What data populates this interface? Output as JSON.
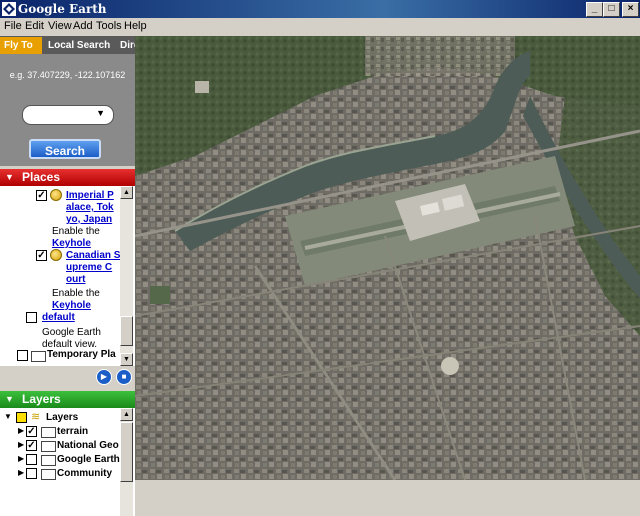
{
  "window": {
    "title": "Google Earth",
    "minimize": "_",
    "maximize": "□",
    "close": "×"
  },
  "menu": [
    "File",
    "Edit",
    "View",
    "Add",
    "Tools",
    "Help"
  ],
  "tabs": [
    "Fly To",
    "Local Search",
    "Dire"
  ],
  "flyto": {
    "hint": "e.g. 37.407229, -122.107162",
    "search_label": "Search"
  },
  "places": {
    "header": "Places",
    "items": [
      {
        "lines": [
          "Imperial P",
          "alace, Tok",
          "yo, Japan"
        ],
        "checked": true,
        "type": "placemark"
      },
      {
        "lines": [
          "Enable the"
        ],
        "type": "text"
      },
      {
        "lines": [
          "Keyhole"
        ],
        "type": "link"
      },
      {
        "lines": [
          "Canadian S",
          "upreme C",
          "ourt"
        ],
        "checked": true,
        "type": "placemark"
      },
      {
        "lines": [
          "Enable the"
        ],
        "type": "text"
      },
      {
        "lines": [
          "Keyhole"
        ],
        "type": "link"
      },
      {
        "lines": [
          "default"
        ],
        "checked": false,
        "type": "link"
      },
      {
        "lines": [
          "Google Earth",
          "default view."
        ],
        "type": "text"
      },
      {
        "lines": [
          "Temporary Pla"
        ],
        "checked": false,
        "type": "folder"
      }
    ]
  },
  "layers": {
    "header": "Layers",
    "root": "Layers",
    "items": [
      {
        "label": "terrain",
        "checked": true
      },
      {
        "label": "National Geo",
        "checked": true
      },
      {
        "label": "Google Earth",
        "checked": false
      },
      {
        "label": "Community",
        "checked": false
      }
    ]
  },
  "colors": {
    "places_header": "#d21a1a",
    "layers_header": "#2a9a2a",
    "active_tab": "#e8a000",
    "link": "#0000cc"
  },
  "icons": {
    "play": "play-icon",
    "stop": "stop-icon"
  }
}
